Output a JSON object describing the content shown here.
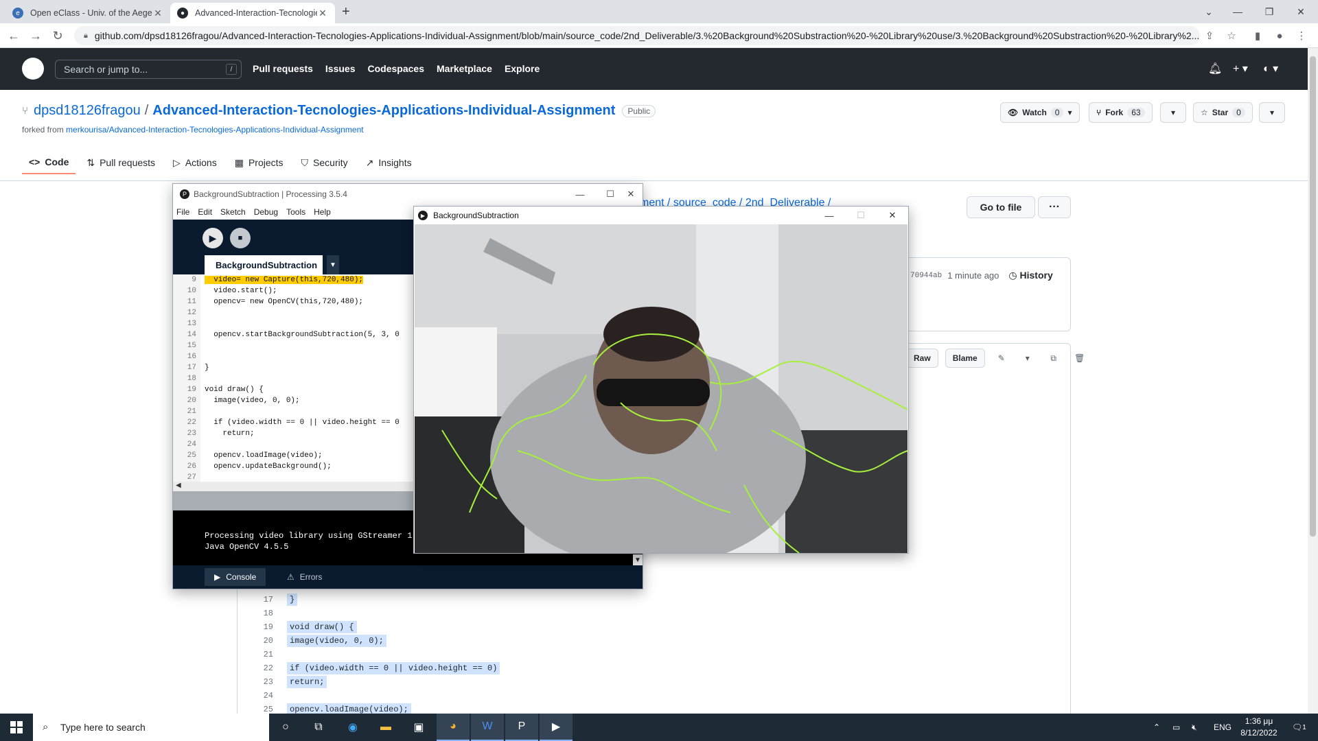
{
  "browser": {
    "tabs": [
      {
        "title": "Open eClass - Univ. of the Aegean"
      },
      {
        "title": "Advanced-Interaction-Tecnologies-"
      }
    ],
    "url": "github.com/dpsd18126fragou/Advanced-Interaction-Tecnologies-Applications-Individual-Assignment/blob/main/source_code/2nd_Deliverable/3.%20Background%20Substraction%20-%20Library%20use/3.%20Background%20Substraction%20-%20Library%2..."
  },
  "github": {
    "search_placeholder": "Search or jump to...",
    "search_key": "/",
    "nav": [
      "Pull requests",
      "Issues",
      "Codespaces",
      "Marketplace",
      "Explore"
    ],
    "owner": "dpsd18126fragou",
    "separator": "/",
    "repo": "Advanced-Interaction-Tecnologies-Applications-Individual-Assignment",
    "visibility": "Public",
    "forked_prefix": "forked from",
    "forked_from": "merkourisa/Advanced-Interaction-Tecnologies-Applications-Individual-Assignment",
    "watch": {
      "label": "Watch",
      "count": "0"
    },
    "fork": {
      "label": "Fork",
      "count": "63"
    },
    "star": {
      "label": "Star",
      "count": "0"
    },
    "tabs": [
      "Code",
      "Pull requests",
      "Actions",
      "Projects",
      "Security",
      "Insights"
    ],
    "breadcrumb": "ment / source_code / 2nd_Deliverable /",
    "goto_file": "Go to file",
    "commit_hash": "70944ab",
    "commit_time": "1 minute ago",
    "history": "History",
    "file_actions": [
      "Raw",
      "Blame"
    ],
    "code_lines": [
      {
        "n": "17",
        "t": "}"
      },
      {
        "n": "18",
        "t": ""
      },
      {
        "n": "19",
        "t": "void draw() {"
      },
      {
        "n": "20",
        "t": "  image(video, 0, 0);"
      },
      {
        "n": "21",
        "t": ""
      },
      {
        "n": "22",
        "t": "  if (video.width == 0 || video.height == 0)"
      },
      {
        "n": "23",
        "t": "    return;"
      },
      {
        "n": "24",
        "t": ""
      },
      {
        "n": "25",
        "t": "  opencv.loadImage(video);"
      }
    ]
  },
  "processing": {
    "title": "BackgroundSubtraction | Processing 3.5.4",
    "menu": [
      "File",
      "Edit",
      "Sketch",
      "Debug",
      "Tools",
      "Help"
    ],
    "tab": "BackgroundSubtraction",
    "lines": [
      {
        "n": "9",
        "t": "  video= new Capture(this,720,480);"
      },
      {
        "n": "10",
        "t": "  video.start();"
      },
      {
        "n": "11",
        "t": "  opencv= new OpenCV(this,720,480);"
      },
      {
        "n": "12",
        "t": ""
      },
      {
        "n": "13",
        "t": ""
      },
      {
        "n": "14",
        "t": "  opencv.startBackgroundSubtraction(5, 3, 0"
      },
      {
        "n": "15",
        "t": ""
      },
      {
        "n": "16",
        "t": ""
      },
      {
        "n": "17",
        "t": "}"
      },
      {
        "n": "18",
        "t": ""
      },
      {
        "n": "19",
        "t": "void draw() {"
      },
      {
        "n": "20",
        "t": "  image(video, 0, 0);"
      },
      {
        "n": "21",
        "t": ""
      },
      {
        "n": "22",
        "t": "  if (video.width == 0 || video.height == 0"
      },
      {
        "n": "23",
        "t": "    return;"
      },
      {
        "n": "24",
        "t": ""
      },
      {
        "n": "25",
        "t": "  opencv.loadImage(video);"
      },
      {
        "n": "26",
        "t": "  opencv.updateBackground();"
      },
      {
        "n": "27",
        "t": ""
      }
    ],
    "console": [
      "Processing video library using GStreamer 1.",
      "Java OpenCV 4.5.5"
    ],
    "bottom_tabs": [
      "Console",
      "Errors"
    ]
  },
  "sketch_window": {
    "title": "BackgroundSubtraction",
    "contour_color": "#a6f03c"
  },
  "taskbar": {
    "search_placeholder": "Type here to search",
    "language": "ENG",
    "time": "1:36 μμ",
    "date": "8/12/2022",
    "notification_count": "1"
  }
}
